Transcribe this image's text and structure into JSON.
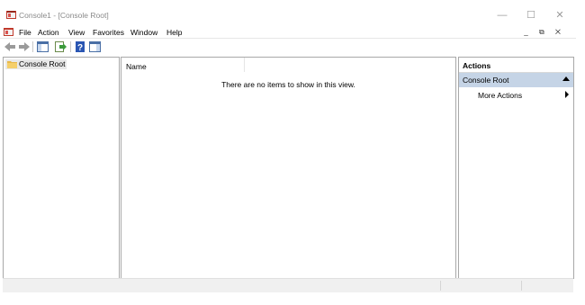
{
  "window": {
    "title": "Console1 - [Console Root]",
    "controls": {
      "minimize": "—",
      "maximize": "☐",
      "close": "✕"
    }
  },
  "menubar": {
    "items": [
      "File",
      "Action",
      "View",
      "Favorites",
      "Window",
      "Help"
    ],
    "mdi_controls": "_ ⧉ ✕"
  },
  "toolbar": {
    "icons": [
      "back-arrow-icon",
      "forward-arrow-icon",
      "show-hide-tree-icon",
      "export-list-icon",
      "help-icon",
      "show-hide-action-pane-icon"
    ]
  },
  "tree": {
    "root_label": "Console Root"
  },
  "list": {
    "column_name": "Name",
    "empty_message": "There are no items to show in this view."
  },
  "actions": {
    "title": "Actions",
    "section_label": "Console Root",
    "items": [
      "More Actions"
    ]
  },
  "colors": {
    "section_highlight": "#c5d4e6",
    "tree_selection": "#e8e8e8",
    "pane_border": "#a8a8a8"
  }
}
